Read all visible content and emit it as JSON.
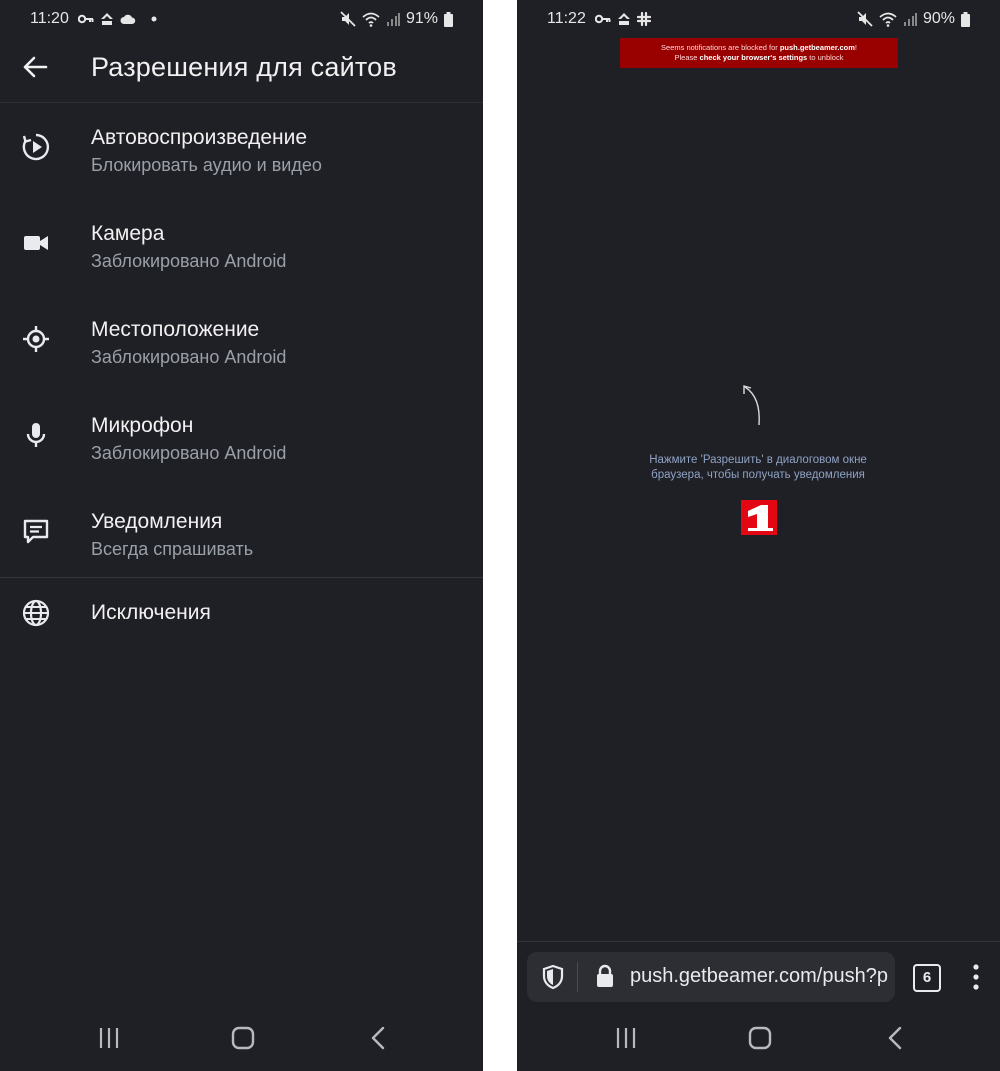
{
  "left": {
    "status": {
      "time": "11:20",
      "battery": "91%"
    },
    "title": "Разрешения для сайтов",
    "items": [
      {
        "title": "Автовоспроизведение",
        "subtitle": "Блокировать аудио и видео",
        "icon": "autoplay-icon"
      },
      {
        "title": "Камера",
        "subtitle": "Заблокировано Android",
        "icon": "camera-icon"
      },
      {
        "title": "Местоположение",
        "subtitle": "Заблокировано Android",
        "icon": "location-icon"
      },
      {
        "title": "Микрофон",
        "subtitle": "Заблокировано Android",
        "icon": "microphone-icon"
      },
      {
        "title": "Уведомления",
        "subtitle": "Всегда спрашивать",
        "icon": "notifications-icon"
      }
    ],
    "exceptions": {
      "title": "Исключения",
      "icon": "globe-icon"
    }
  },
  "right": {
    "status": {
      "time": "11:22",
      "battery": "90%"
    },
    "banner": {
      "line1_prefix": "Seems notifications are blocked for ",
      "line1_bold": "push.getbeamer.com",
      "line1_suffix": "!",
      "line2_prefix": "Please ",
      "line2_bold": "check your browser's settings",
      "line2_suffix": " to unblock"
    },
    "prompt": "Нажмите 'Разрешить' в диалоговом окне браузера, чтобы получать уведомления",
    "url": "push.getbeamer.com/push?p",
    "tab_count": "6"
  },
  "colors": {
    "background": "#1f1f26",
    "banner": "#990000",
    "logo_red": "#e30613",
    "prompt_text": "#8fa3c4"
  }
}
